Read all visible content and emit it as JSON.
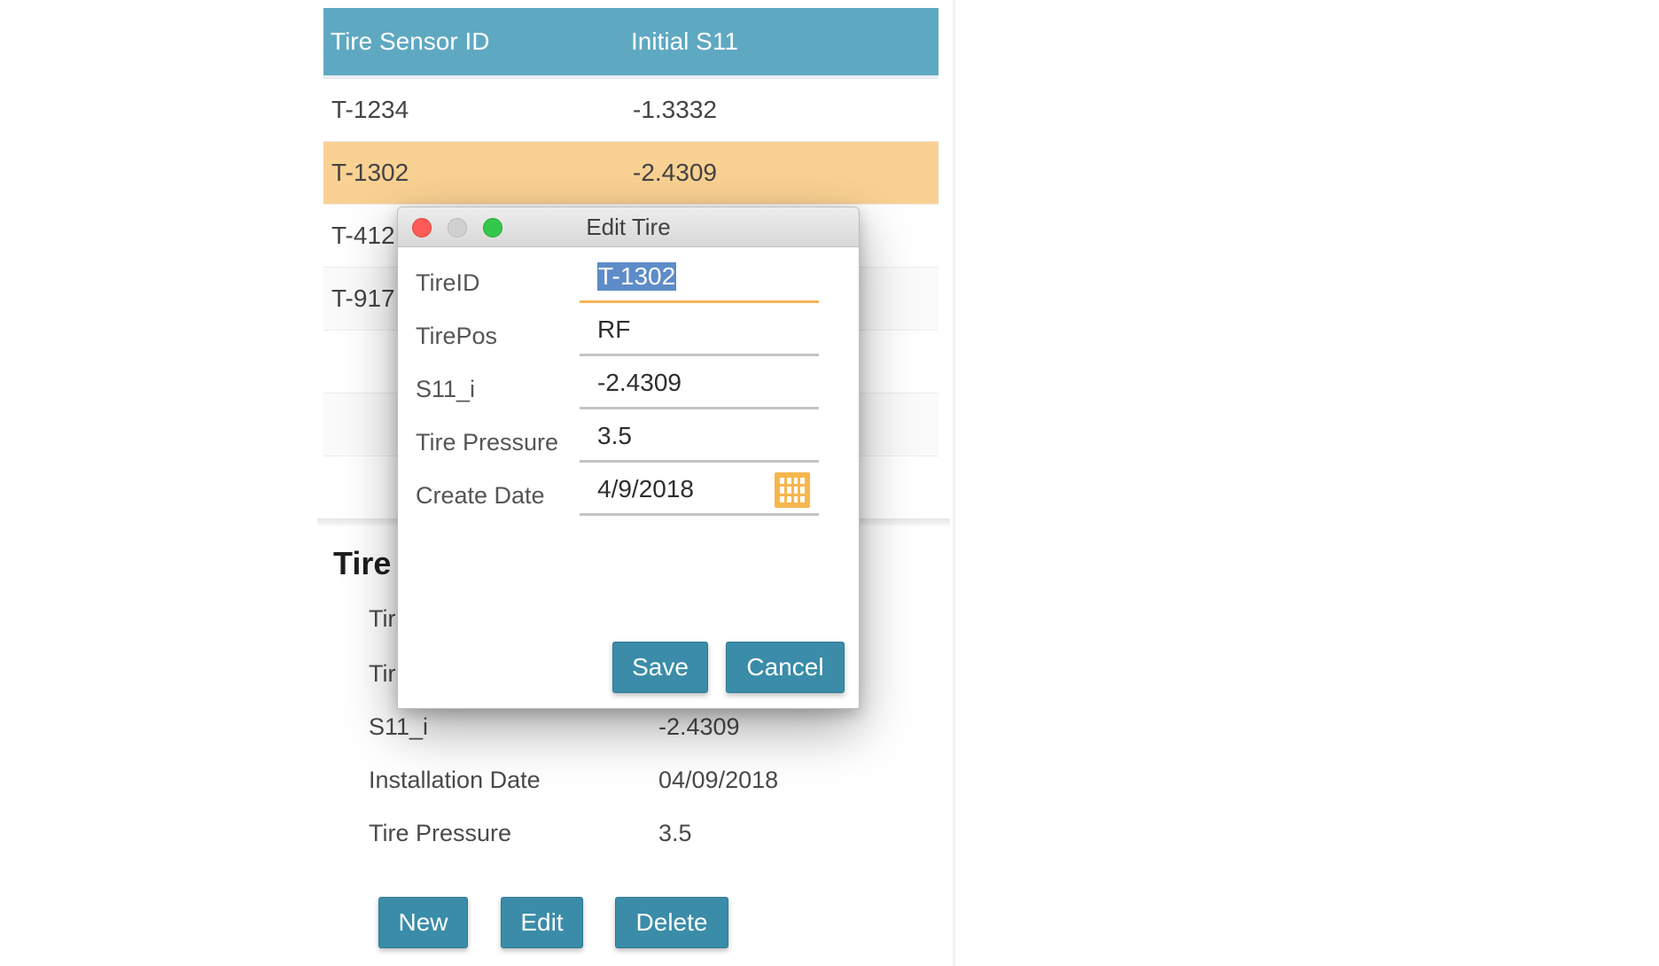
{
  "table": {
    "headers": [
      "Tire Sensor ID",
      "Initial S11"
    ],
    "rows": [
      {
        "id": "T-1234",
        "s11": "-1.3332"
      },
      {
        "id": "T-1302",
        "s11": "-2.4309"
      },
      {
        "id": "T-412",
        "s11": ""
      },
      {
        "id": "T-917",
        "s11": ""
      }
    ]
  },
  "details": {
    "title": "Tire",
    "rows": [
      {
        "label": "Tir",
        "value": ""
      },
      {
        "label": "Tir",
        "value": ""
      },
      {
        "label": "S11_i",
        "value": "-2.4309"
      },
      {
        "label": "Installation Date",
        "value": "04/09/2018"
      },
      {
        "label": "Tire Pressure",
        "value": "3.5"
      }
    ]
  },
  "buttons": {
    "new": "New",
    "edit": "Edit",
    "delete": "Delete"
  },
  "dialog": {
    "title": "Edit Tire",
    "fields": [
      {
        "label": "TireID",
        "value": "T-1302"
      },
      {
        "label": "TirePos",
        "value": "RF"
      },
      {
        "label": "S11_i",
        "value": "-2.4309"
      },
      {
        "label": "Tire Pressure",
        "value": "3.5"
      },
      {
        "label": "Create Date",
        "value": "4/9/2018"
      }
    ],
    "save": "Save",
    "cancel": "Cancel"
  },
  "icons": {
    "date_picker": "calendar-icon"
  },
  "colors": {
    "header": "#5fa8c2",
    "selected_row": "#f9d192",
    "button": "#3a8ca8",
    "focus": "#f5b65a"
  }
}
